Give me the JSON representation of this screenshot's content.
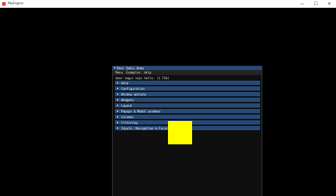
{
  "app": {
    "title": "MyEngine",
    "minimize_glyph": "—",
    "maximize_glyph": "☐",
    "close_glyph": "✕"
  },
  "imgui": {
    "window_title": "Dear ImGui Demo",
    "collapse_glyph": "▼",
    "menu": [
      "Menu",
      "Examples",
      "Help"
    ],
    "greeting": "dear imgui says hello. (1.72b)",
    "header_glyph": "▶",
    "headers": [
      "Help",
      "Configuration",
      "Window options",
      "Widgets",
      "Layout",
      "Popups & Modal windows",
      "Columns",
      "Filtering",
      "Inputs, Navigation & Focus"
    ]
  },
  "colors": {
    "title_bg": "#294a7a",
    "header_bg": "#264a78",
    "square": "#ffff00"
  }
}
